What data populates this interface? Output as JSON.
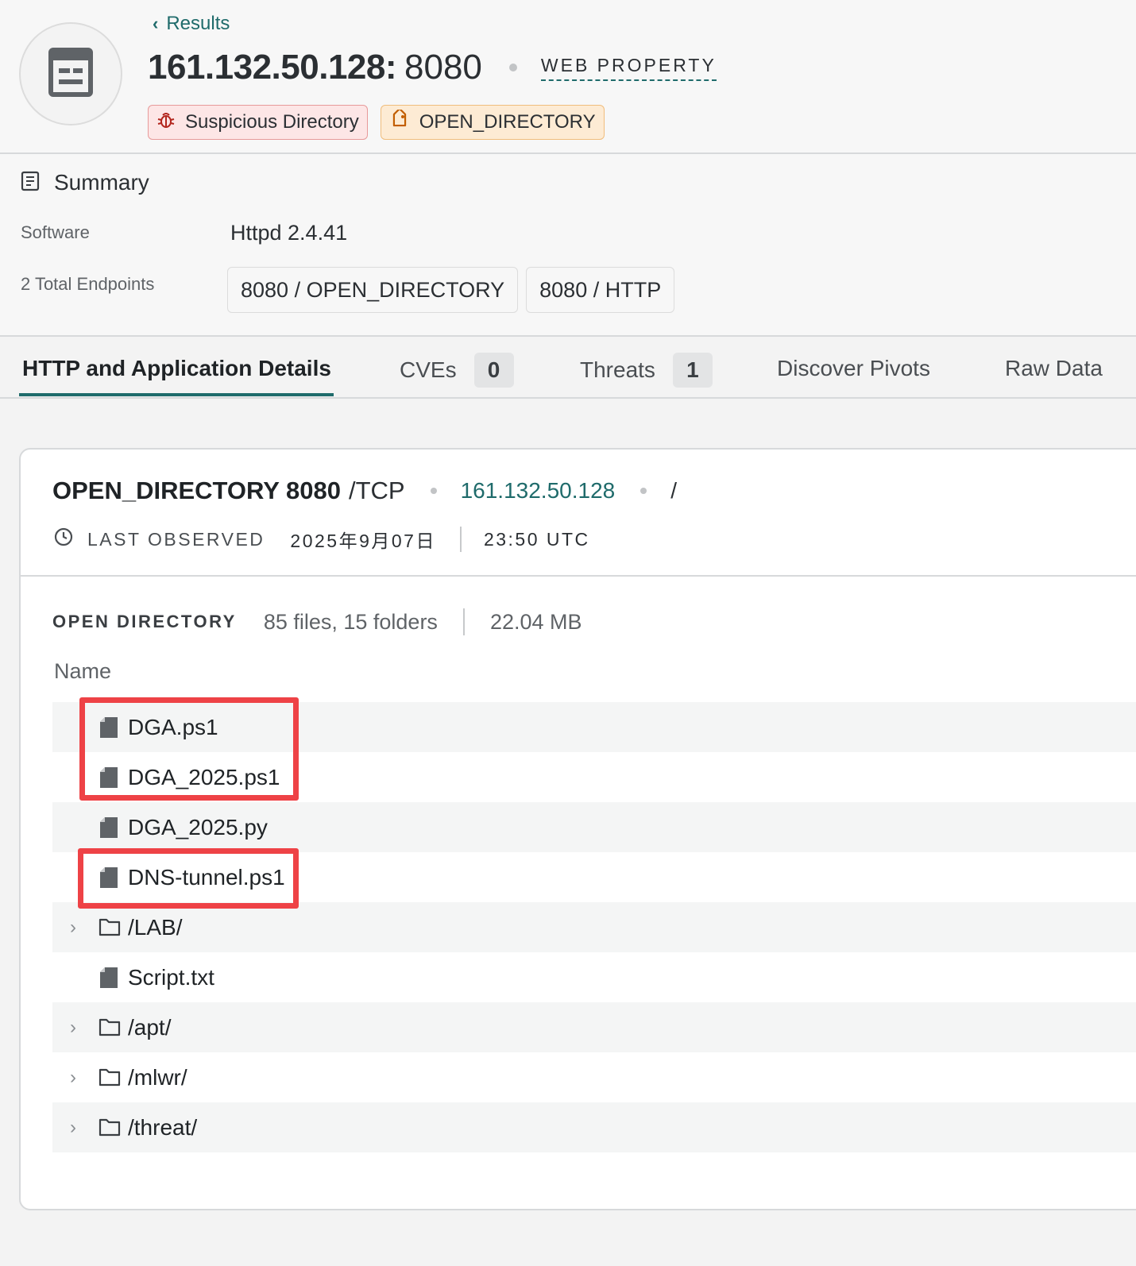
{
  "header": {
    "back_label": "Results",
    "ip": "161.132.50.128:",
    "port": "8080",
    "property_type": "WEB PROPERTY",
    "badges": [
      {
        "label": "Suspicious Directory",
        "icon": "bug-icon"
      },
      {
        "label": "OPEN_DIRECTORY",
        "icon": "tag-icon"
      }
    ]
  },
  "summary": {
    "title": "Summary",
    "software_label": "Software",
    "software_value": "Httpd 2.4.41",
    "endpoints_label": "2 Total Endpoints",
    "endpoints": [
      "8080 / OPEN_DIRECTORY",
      "8080 / HTTP"
    ]
  },
  "tabs": [
    {
      "label": "HTTP and Application Details",
      "active": true
    },
    {
      "label": "CVEs",
      "count": "0"
    },
    {
      "label": "Threats",
      "count": "1"
    },
    {
      "label": "Discover Pivots"
    },
    {
      "label": "Raw Data"
    }
  ],
  "service": {
    "name": "OPEN_DIRECTORY 8080",
    "protocol": "/TCP",
    "ip": "161.132.50.128",
    "path": "/",
    "last_observed_label": "LAST OBSERVED",
    "date": "2025年9月07日",
    "time": "23:50 UTC"
  },
  "directory": {
    "label": "OPEN DIRECTORY",
    "counts": "85 files, 15 folders",
    "size": "22.04 MB",
    "name_header": "Name",
    "entries": [
      {
        "name": "DGA.ps1",
        "type": "file",
        "highlighted": true
      },
      {
        "name": "DGA_2025.ps1",
        "type": "file",
        "highlighted": true
      },
      {
        "name": "DGA_2025.py",
        "type": "file",
        "highlighted": false
      },
      {
        "name": "DNS-tunnel.ps1",
        "type": "file",
        "highlighted": true
      },
      {
        "name": "/LAB/",
        "type": "folder",
        "highlighted": false
      },
      {
        "name": "Script.txt",
        "type": "file",
        "highlighted": false
      },
      {
        "name": "/apt/",
        "type": "folder",
        "highlighted": false
      },
      {
        "name": "/mlwr/",
        "type": "folder",
        "highlighted": false
      },
      {
        "name": "/threat/",
        "type": "folder",
        "highlighted": false
      }
    ]
  },
  "colors": {
    "accent": "#1f6b6b",
    "highlight": "#ee4246",
    "badge_red_bg": "#fde6e6",
    "badge_orange_bg": "#fdebd4"
  }
}
